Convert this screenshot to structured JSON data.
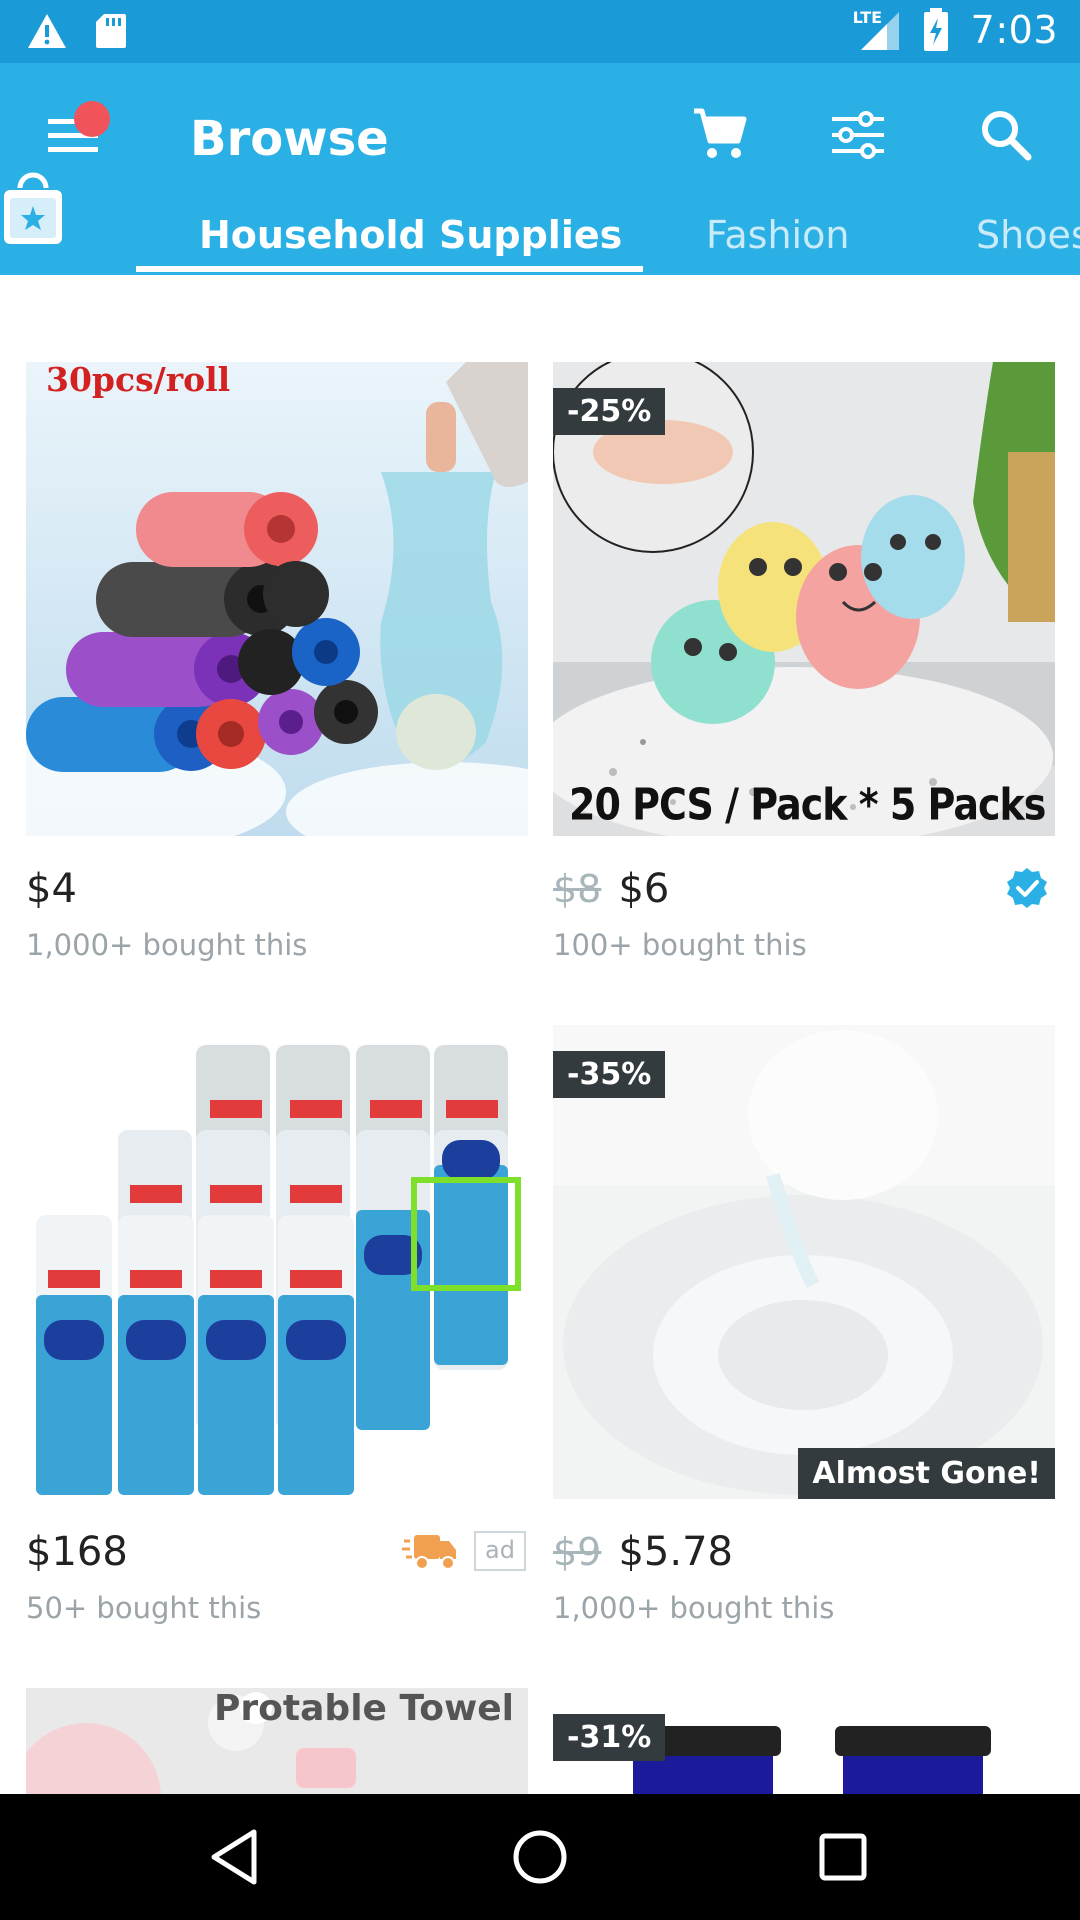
{
  "status_bar": {
    "time": "7:03",
    "network": "LTE",
    "icons": [
      "warning-icon",
      "sd-card-icon",
      "signal-icon",
      "battery-charging-icon"
    ]
  },
  "app_bar": {
    "title": "Browse",
    "notification_dot_color": "#f0535a",
    "actions": [
      "cart-icon",
      "filter-icon",
      "search-icon"
    ]
  },
  "tabs": [
    {
      "label": "Household Supplies",
      "active": true
    },
    {
      "label": "Fashion",
      "active": false
    },
    {
      "label": "Shoes",
      "active": false
    }
  ],
  "products": [
    {
      "image_text": "30pcs/roll",
      "price": "$4",
      "old_price": "",
      "sold": "1,000+ bought this",
      "discount": "",
      "verified": false
    },
    {
      "image_text": "20 PCS / Pack * 5 Packs",
      "price": "$6",
      "old_price": "$8",
      "sold": "100+ bought this",
      "discount": "-25%",
      "verified": true
    },
    {
      "image_text": "",
      "price": "$168",
      "old_price": "",
      "sold": "50+ bought this",
      "discount": "",
      "ad_label": "ad",
      "fast_shipping": true
    },
    {
      "image_text": "",
      "price": "$5.78",
      "old_price": "$9",
      "sold": "1,000+ bought this",
      "discount": "-35%",
      "status": "Almost Gone!"
    },
    {
      "image_text": "Protable Towel",
      "discount": ""
    },
    {
      "image_text": "",
      "discount": "-31%"
    }
  ],
  "colors": {
    "status_bar": "#1a9ad6",
    "app_bar": "#2bb0e5",
    "badge_bg": "#333b3f",
    "verified": "#2bb0e5",
    "truck": "#f0a050"
  }
}
